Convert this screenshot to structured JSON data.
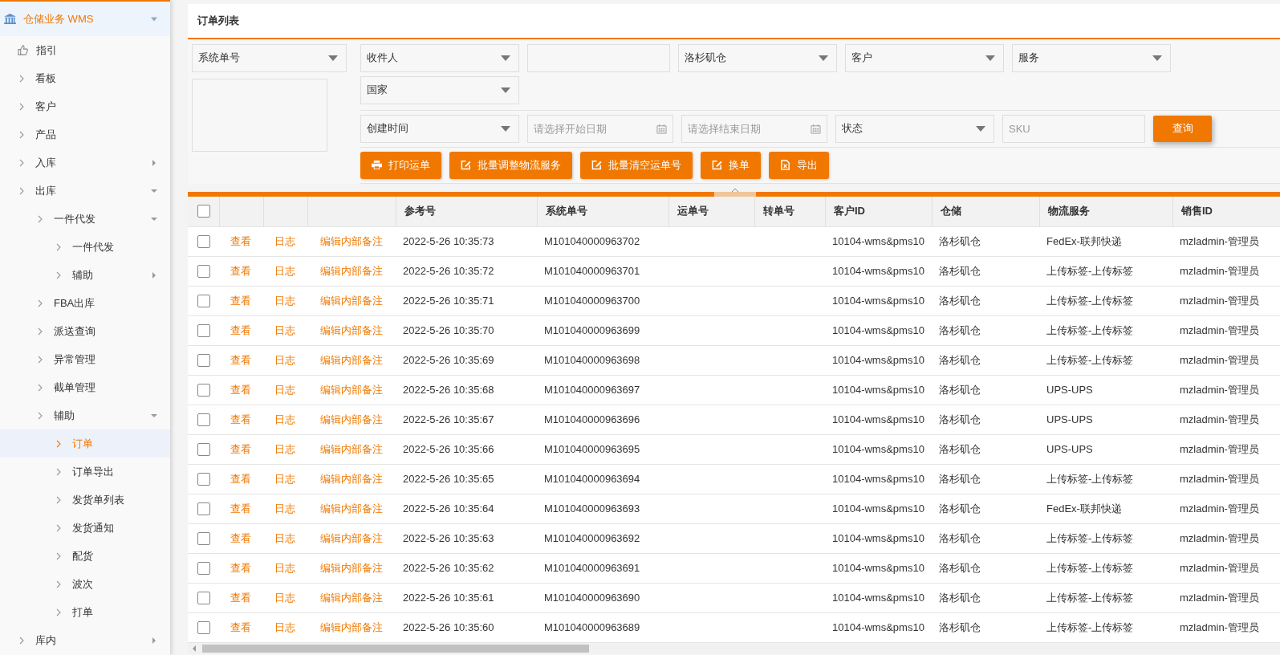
{
  "sidebar": {
    "header": {
      "label": "仓储业务 WMS",
      "expanded": true
    },
    "items": [
      {
        "label": "指引",
        "kind": "guide",
        "selected": false
      },
      {
        "label": "看板",
        "kind": "menu",
        "selected": false
      },
      {
        "label": "客户",
        "kind": "menu",
        "selected": false
      },
      {
        "label": "产品",
        "kind": "menu",
        "selected": false
      },
      {
        "label": "入库",
        "kind": "menu",
        "selected": false,
        "expanded": false
      },
      {
        "label": "出库",
        "kind": "menu",
        "selected": false,
        "expanded": true,
        "children": [
          {
            "label": "一件代发",
            "kind": "menu",
            "selected": false,
            "expanded": true,
            "children": [
              {
                "label": "一件代发",
                "kind": "menu",
                "selected": false
              },
              {
                "label": "辅助",
                "kind": "menu",
                "selected": false,
                "expanded": false
              }
            ]
          },
          {
            "label": "FBA出库",
            "kind": "menu",
            "selected": false
          },
          {
            "label": "派送查询",
            "kind": "menu",
            "selected": false
          },
          {
            "label": "异常管理",
            "kind": "menu",
            "selected": false
          },
          {
            "label": "截单管理",
            "kind": "menu",
            "selected": false
          },
          {
            "label": "辅助",
            "kind": "menu",
            "selected": false,
            "expanded": true,
            "children": [
              {
                "label": "订单",
                "kind": "menu",
                "selected": true
              },
              {
                "label": "订单导出",
                "kind": "menu",
                "selected": false
              },
              {
                "label": "发货单列表",
                "kind": "menu",
                "selected": false
              },
              {
                "label": "发货通知",
                "kind": "menu",
                "selected": false
              },
              {
                "label": "配货",
                "kind": "menu",
                "selected": false
              },
              {
                "label": "波次",
                "kind": "menu",
                "selected": false
              },
              {
                "label": "打单",
                "kind": "menu",
                "selected": false
              }
            ]
          }
        ]
      },
      {
        "label": "库内",
        "kind": "menu",
        "selected": false,
        "expanded": false
      }
    ]
  },
  "panel": {
    "title": "订单列表"
  },
  "search_type": {
    "value": "系统单号"
  },
  "filters": [
    {
      "kind": "select",
      "value": "收件人"
    },
    {
      "kind": "input"
    },
    {
      "kind": "select",
      "value": "洛杉矶仓"
    },
    {
      "kind": "select",
      "value": "客户"
    },
    {
      "kind": "select",
      "value": "服务"
    },
    {
      "kind": "select",
      "value": "国家"
    }
  ],
  "date_filters": [
    {
      "kind": "select",
      "value": "创建时间"
    },
    {
      "kind": "date",
      "placeholder": "请选择开始日期"
    },
    {
      "kind": "date",
      "placeholder": "请选择结束日期"
    },
    {
      "kind": "select",
      "value": "状态"
    },
    {
      "kind": "input",
      "placeholder": "SKU"
    }
  ],
  "query_button": "查询",
  "actions": [
    {
      "kind": "print",
      "label": "打印运单"
    },
    {
      "kind": "edit",
      "label": "批量调整物流服务"
    },
    {
      "kind": "edit",
      "label": "批量清空运单号"
    },
    {
      "kind": "edit",
      "label": "换单"
    },
    {
      "kind": "export",
      "label": "导出"
    }
  ],
  "table": {
    "select_all": {
      "checked": false
    },
    "columns": [
      "参考号",
      "系统单号",
      "运单号",
      "转单号",
      "客户ID",
      "仓储",
      "物流服务",
      "销售ID"
    ],
    "rows": [
      {
        "checked": false,
        "actions": [
          "查看",
          "日志",
          "编辑内部备注"
        ],
        "reference": "2022-5-26 10:35:73",
        "system_no": "M101040000963702",
        "customer_id": "10104-wms&pms10",
        "warehouse": "洛杉矶仓",
        "service": "FedEx-联邦快递",
        "sales_id": "mzladmin-管理员"
      },
      {
        "checked": false,
        "actions": [
          "查看",
          "日志",
          "编辑内部备注"
        ],
        "reference": "2022-5-26 10:35:72",
        "system_no": "M101040000963701",
        "customer_id": "10104-wms&pms10",
        "warehouse": "洛杉矶仓",
        "service": "上传标签-上传标签",
        "sales_id": "mzladmin-管理员"
      },
      {
        "checked": false,
        "actions": [
          "查看",
          "日志",
          "编辑内部备注"
        ],
        "reference": "2022-5-26 10:35:71",
        "system_no": "M101040000963700",
        "customer_id": "10104-wms&pms10",
        "warehouse": "洛杉矶仓",
        "service": "上传标签-上传标签",
        "sales_id": "mzladmin-管理员"
      },
      {
        "checked": false,
        "actions": [
          "查看",
          "日志",
          "编辑内部备注"
        ],
        "reference": "2022-5-26 10:35:70",
        "system_no": "M101040000963699",
        "customer_id": "10104-wms&pms10",
        "warehouse": "洛杉矶仓",
        "service": "上传标签-上传标签",
        "sales_id": "mzladmin-管理员"
      },
      {
        "checked": false,
        "actions": [
          "查看",
          "日志",
          "编辑内部备注"
        ],
        "reference": "2022-5-26 10:35:69",
        "system_no": "M101040000963698",
        "customer_id": "10104-wms&pms10",
        "warehouse": "洛杉矶仓",
        "service": "上传标签-上传标签",
        "sales_id": "mzladmin-管理员"
      },
      {
        "checked": false,
        "actions": [
          "查看",
          "日志",
          "编辑内部备注"
        ],
        "reference": "2022-5-26 10:35:68",
        "system_no": "M101040000963697",
        "customer_id": "10104-wms&pms10",
        "warehouse": "洛杉矶仓",
        "service": "UPS-UPS",
        "sales_id": "mzladmin-管理员"
      },
      {
        "checked": false,
        "actions": [
          "查看",
          "日志",
          "编辑内部备注"
        ],
        "reference": "2022-5-26 10:35:67",
        "system_no": "M101040000963696",
        "customer_id": "10104-wms&pms10",
        "warehouse": "洛杉矶仓",
        "service": "UPS-UPS",
        "sales_id": "mzladmin-管理员"
      },
      {
        "checked": false,
        "actions": [
          "查看",
          "日志",
          "编辑内部备注"
        ],
        "reference": "2022-5-26 10:35:66",
        "system_no": "M101040000963695",
        "customer_id": "10104-wms&pms10",
        "warehouse": "洛杉矶仓",
        "service": "UPS-UPS",
        "sales_id": "mzladmin-管理员"
      },
      {
        "checked": false,
        "actions": [
          "查看",
          "日志",
          "编辑内部备注"
        ],
        "reference": "2022-5-26 10:35:65",
        "system_no": "M101040000963694",
        "customer_id": "10104-wms&pms10",
        "warehouse": "洛杉矶仓",
        "service": "上传标签-上传标签",
        "sales_id": "mzladmin-管理员"
      },
      {
        "checked": false,
        "actions": [
          "查看",
          "日志",
          "编辑内部备注"
        ],
        "reference": "2022-5-26 10:35:64",
        "system_no": "M101040000963693",
        "customer_id": "10104-wms&pms10",
        "warehouse": "洛杉矶仓",
        "service": "FedEx-联邦快递",
        "sales_id": "mzladmin-管理员"
      },
      {
        "checked": false,
        "actions": [
          "查看",
          "日志",
          "编辑内部备注"
        ],
        "reference": "2022-5-26 10:35:63",
        "system_no": "M101040000963692",
        "customer_id": "10104-wms&pms10",
        "warehouse": "洛杉矶仓",
        "service": "上传标签-上传标签",
        "sales_id": "mzladmin-管理员"
      },
      {
        "checked": false,
        "actions": [
          "查看",
          "日志",
          "编辑内部备注"
        ],
        "reference": "2022-5-26 10:35:62",
        "system_no": "M101040000963691",
        "customer_id": "10104-wms&pms10",
        "warehouse": "洛杉矶仓",
        "service": "上传标签-上传标签",
        "sales_id": "mzladmin-管理员"
      },
      {
        "checked": false,
        "actions": [
          "查看",
          "日志",
          "编辑内部备注"
        ],
        "reference": "2022-5-26 10:35:61",
        "system_no": "M101040000963690",
        "customer_id": "10104-wms&pms10",
        "warehouse": "洛杉矶仓",
        "service": "上传标签-上传标签",
        "sales_id": "mzladmin-管理员"
      },
      {
        "checked": false,
        "actions": [
          "查看",
          "日志",
          "编辑内部备注"
        ],
        "reference": "2022-5-26 10:35:60",
        "system_no": "M101040000963689",
        "customer_id": "10104-wms&pms10",
        "warehouse": "洛杉矶仓",
        "service": "上传标签-上传标签",
        "sales_id": "mzladmin-管理员"
      }
    ]
  }
}
